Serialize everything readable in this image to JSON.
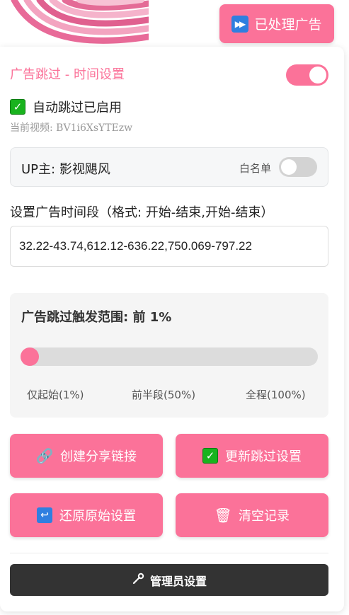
{
  "top_button": {
    "icon": "fast-forward-icon",
    "label": "已处理广告"
  },
  "header": {
    "title": "广告跳过 - 时间设置",
    "enabled": true
  },
  "status": {
    "icon": "check-icon",
    "text": "自动跳过已启用"
  },
  "video": {
    "label": "当前视频: BV1i6XsYTEzw"
  },
  "up": {
    "name": "UP主: 影视飓风",
    "whitelist_label": "白名单",
    "whitelisted": false
  },
  "range": {
    "label": "设置广告时间段（格式: 开始-结束,开始-结束）",
    "value": "32.22-43.74,612.12-636.22,750.069-797.22"
  },
  "trigger": {
    "title": "广告跳过触发范围: 前 1%",
    "percent": 1,
    "labels": [
      "仅起始(1%)",
      "前半段(50%)",
      "全程(100%)"
    ]
  },
  "buttons": {
    "share": {
      "icon": "paperclip-icon",
      "label": "创建分享链接"
    },
    "update": {
      "icon": "check-icon",
      "label": "更新跳过设置"
    },
    "restore": {
      "icon": "return-icon",
      "label": "还原原始设置"
    },
    "clear": {
      "icon": "trash-icon",
      "label": "清空记录"
    }
  },
  "admin": {
    "icon": "wrench-icon",
    "label": "管理员设置"
  },
  "colors": {
    "accent": "#fb7299",
    "dark": "#333333",
    "check": "#19b31e",
    "blue": "#2f7fe0"
  }
}
